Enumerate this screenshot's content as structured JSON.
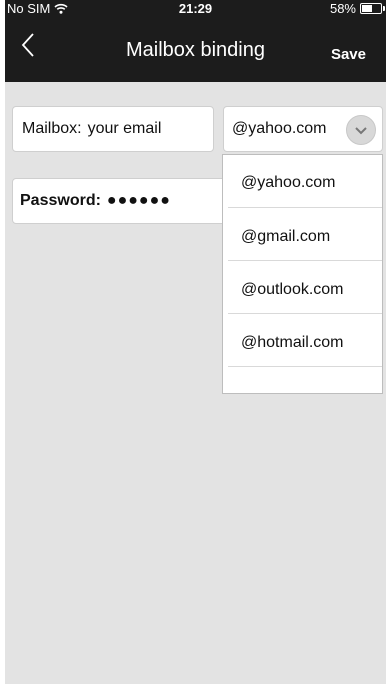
{
  "status_bar": {
    "carrier": "No SIM",
    "time": "21:29",
    "battery_percent": "58%",
    "battery_level": 0.58,
    "wifi_icon": "wifi-icon"
  },
  "nav": {
    "title": "Mailbox binding",
    "save_label": "Save",
    "back_icon": "chevron-left-icon"
  },
  "form": {
    "mailbox": {
      "label": "Mailbox:",
      "placeholder": "your email"
    },
    "domain": {
      "selected": "@yahoo.com",
      "icon": "chevron-down-icon"
    },
    "password": {
      "label": "Password:",
      "value": "●●●●●●"
    }
  },
  "dropdown": {
    "options": [
      {
        "label": "@yahoo.com"
      },
      {
        "label": "@gmail.com"
      },
      {
        "label": "@outlook.com"
      },
      {
        "label": "@hotmail.com"
      }
    ]
  },
  "colors": {
    "bar_background": "#1c1c1c",
    "page_background": "#e3e3e3",
    "field_background": "#ffffff",
    "text": "#111111"
  }
}
